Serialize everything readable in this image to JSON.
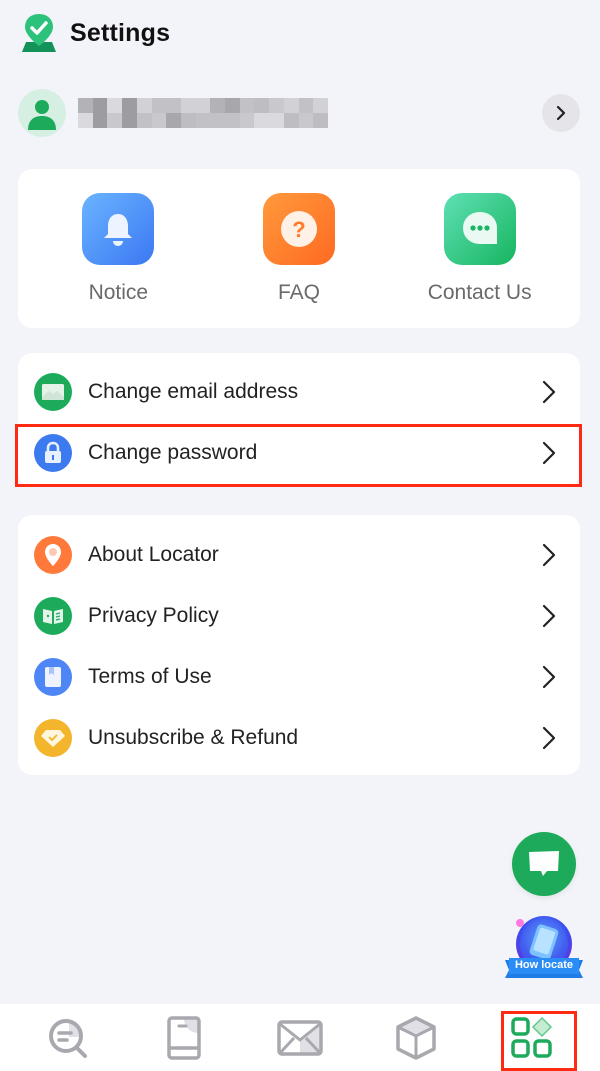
{
  "header": {
    "title": "Settings",
    "logo_icon": "map-pin-check-icon"
  },
  "profile": {
    "name": "[redacted]",
    "avatar_icon": "user-icon",
    "arrow_icon": "chevron-right-icon"
  },
  "quick_actions": [
    {
      "label": "Notice",
      "icon": "bell-icon",
      "color": "#3b78f3"
    },
    {
      "label": "FAQ",
      "icon": "question-icon",
      "color": "#ff6a22"
    },
    {
      "label": "Contact Us",
      "icon": "chat-bubble-icon",
      "color": "#17b55f"
    }
  ],
  "account_items": [
    {
      "label": "Change email address",
      "icon": "envelope-icon",
      "color": "#1dab5b"
    },
    {
      "label": "Change password",
      "icon": "lock-icon",
      "color": "#3c7af0",
      "highlighted": true
    }
  ],
  "info_items": [
    {
      "label": "About Locator",
      "icon": "location-pin-icon",
      "color": "#ff7a3a"
    },
    {
      "label": "Privacy Policy",
      "icon": "book-icon",
      "color": "#1dab5b"
    },
    {
      "label": "Terms of Use",
      "icon": "bookmark-doc-icon",
      "color": "#4e86f5"
    },
    {
      "label": "Unsubscribe & Refund",
      "icon": "diamond-icon",
      "color": "#f2b52c"
    }
  ],
  "floating": {
    "chat_icon": "message-icon",
    "locate_badge": "How locate"
  },
  "tabbar": {
    "tabs": [
      {
        "name": "search",
        "icon": "search-list-icon"
      },
      {
        "name": "book",
        "icon": "book-tab-icon"
      },
      {
        "name": "mail",
        "icon": "mail-icon"
      },
      {
        "name": "package",
        "icon": "box-icon"
      },
      {
        "name": "apps",
        "icon": "apps-grid-icon",
        "selected": true
      }
    ],
    "active_color": "#1dab5b",
    "inactive_color": "#a8a8ae"
  },
  "colors": {
    "highlight": "#ff2a12",
    "background": "#f3f4f9"
  }
}
